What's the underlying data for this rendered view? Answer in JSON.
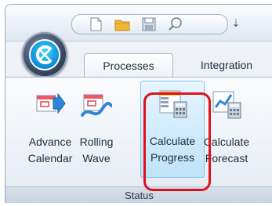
{
  "tabs": [
    {
      "label": "Processes",
      "selected": true
    },
    {
      "label": "Integration",
      "selected": false
    }
  ],
  "ribbon": {
    "buttons": [
      {
        "line1": "Advance",
        "line2": "Calendar",
        "icon": "advance-calendar-icon"
      },
      {
        "line1": "Rolling",
        "line2": "Wave",
        "icon": "rolling-wave-icon"
      },
      {
        "line1": "Calculate",
        "line2": "Progress",
        "icon": "calculate-progress-icon",
        "highlighted": true
      },
      {
        "line1": "Calculate",
        "line2": "Forecast",
        "icon": "calculate-forecast-icon"
      }
    ],
    "group_label": "Status"
  },
  "quick_access": {
    "items": [
      "new-document-icon",
      "open-folder-icon",
      "save-icon",
      "search-icon"
    ],
    "more_glyph": "⇣"
  },
  "colors": {
    "highlight": "#e0101c",
    "orb": "#0e8ed6"
  }
}
